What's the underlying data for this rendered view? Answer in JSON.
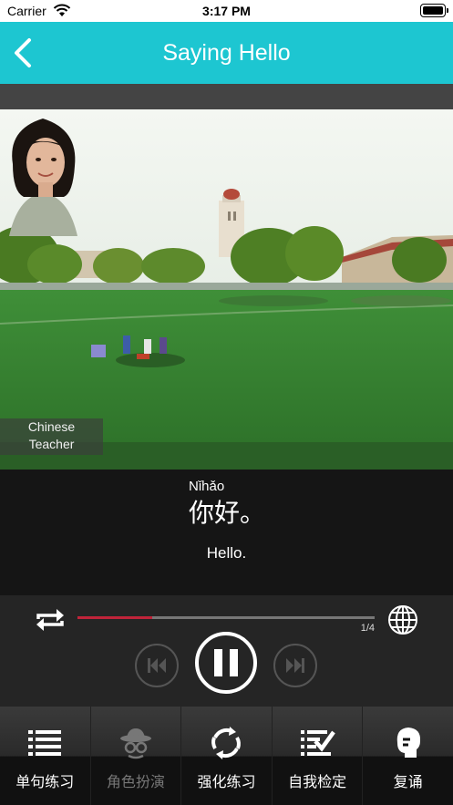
{
  "status_bar": {
    "carrier": "Carrier",
    "time": "3:17 PM"
  },
  "nav": {
    "title": "Saying Hello",
    "back_icon": "chevron-left-icon"
  },
  "colors": {
    "header": "#1dc6d1",
    "progress": "#c0243a"
  },
  "scene": {
    "teacher_label_line1": "Chinese",
    "teacher_label_line2": "Teacher"
  },
  "lesson": {
    "pinyin": "Nǐhǎo",
    "hanzi": "你好。",
    "english": "Hello."
  },
  "player": {
    "counter": "1/4",
    "progress": 0.25,
    "state": "playing"
  },
  "tabs": [
    {
      "label": "单句练习",
      "icon": "list-icon",
      "enabled": true
    },
    {
      "label": "角色扮演",
      "icon": "spy-hat-icon",
      "enabled": false
    },
    {
      "label": "强化练习",
      "icon": "refresh-cycle-icon",
      "enabled": true
    },
    {
      "label": "自我检定",
      "icon": "checklist-icon",
      "enabled": true
    },
    {
      "label": "复诵",
      "icon": "speaking-head-icon",
      "enabled": true
    }
  ]
}
